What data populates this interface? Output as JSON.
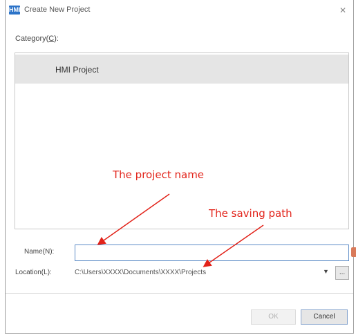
{
  "window": {
    "title": "Create New Project",
    "app_icon": "app-logo-icon",
    "close_glyph": "✕"
  },
  "category": {
    "label_prefix": "Category(",
    "label_hotkey": "C",
    "label_suffix": "):",
    "items": [
      {
        "label": "HMI Project",
        "selected": true
      }
    ]
  },
  "annotations": {
    "project_name": "The project name",
    "saving_path": "The saving path",
    "color": "#e2231a"
  },
  "form": {
    "name_label": "Name(N):",
    "name_value": "",
    "location_label": "Location(L):",
    "location_value": "C:\\Users\\XXXX\\Documents\\XXXX\\Projects",
    "dropdown_glyph": "▼",
    "browse_label": "..."
  },
  "buttons": {
    "ok": "OK",
    "cancel": "Cancel"
  }
}
